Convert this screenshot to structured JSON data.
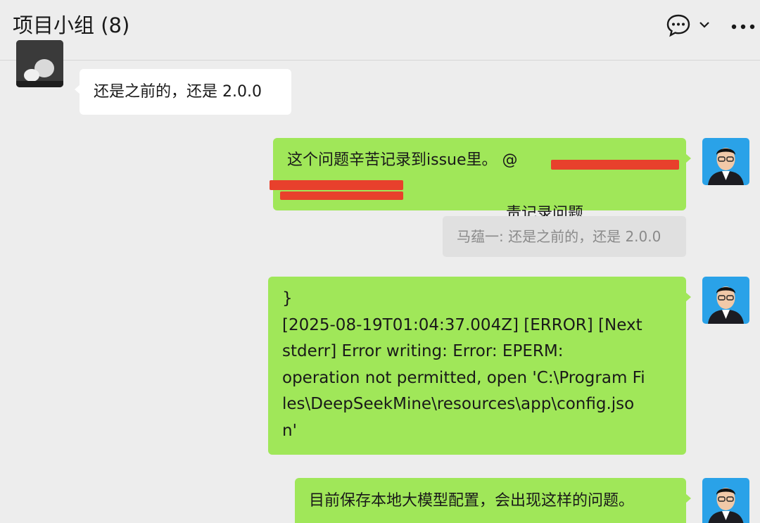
{
  "header": {
    "title": "项目小组 (8)",
    "chat_icon": "chat-bubble-icon",
    "chevron_icon": "chevron-down-icon",
    "more_icon": "more-dots-icon"
  },
  "messages": [
    {
      "sender": "other",
      "text": "还是之前的，还是 2.0.0"
    },
    {
      "sender": "self",
      "line1": "这个问题辛苦记录到issue里。 @",
      "line2": "责记录问题"
    },
    {
      "sender": "quote",
      "text": "马蕴一: 还是之前的，还是 2.0.0"
    },
    {
      "sender": "self",
      "lines": [
        "}",
        "[2025-08-19T01:04:37.004Z] [ERROR] [Next",
        "stderr] Error writing: Error: EPERM:",
        "operation not permitted, open 'C:\\Program Fi",
        "les\\DeepSeekMine\\resources\\app\\config.jso",
        "n'"
      ]
    },
    {
      "sender": "self",
      "text": "目前保存本地大模型配置，会出现这样的问题。"
    }
  ],
  "colors": {
    "background": "#ededed",
    "self_bubble": "#a0e759",
    "other_bubble": "#ffffff",
    "redaction": "#e8402c"
  }
}
